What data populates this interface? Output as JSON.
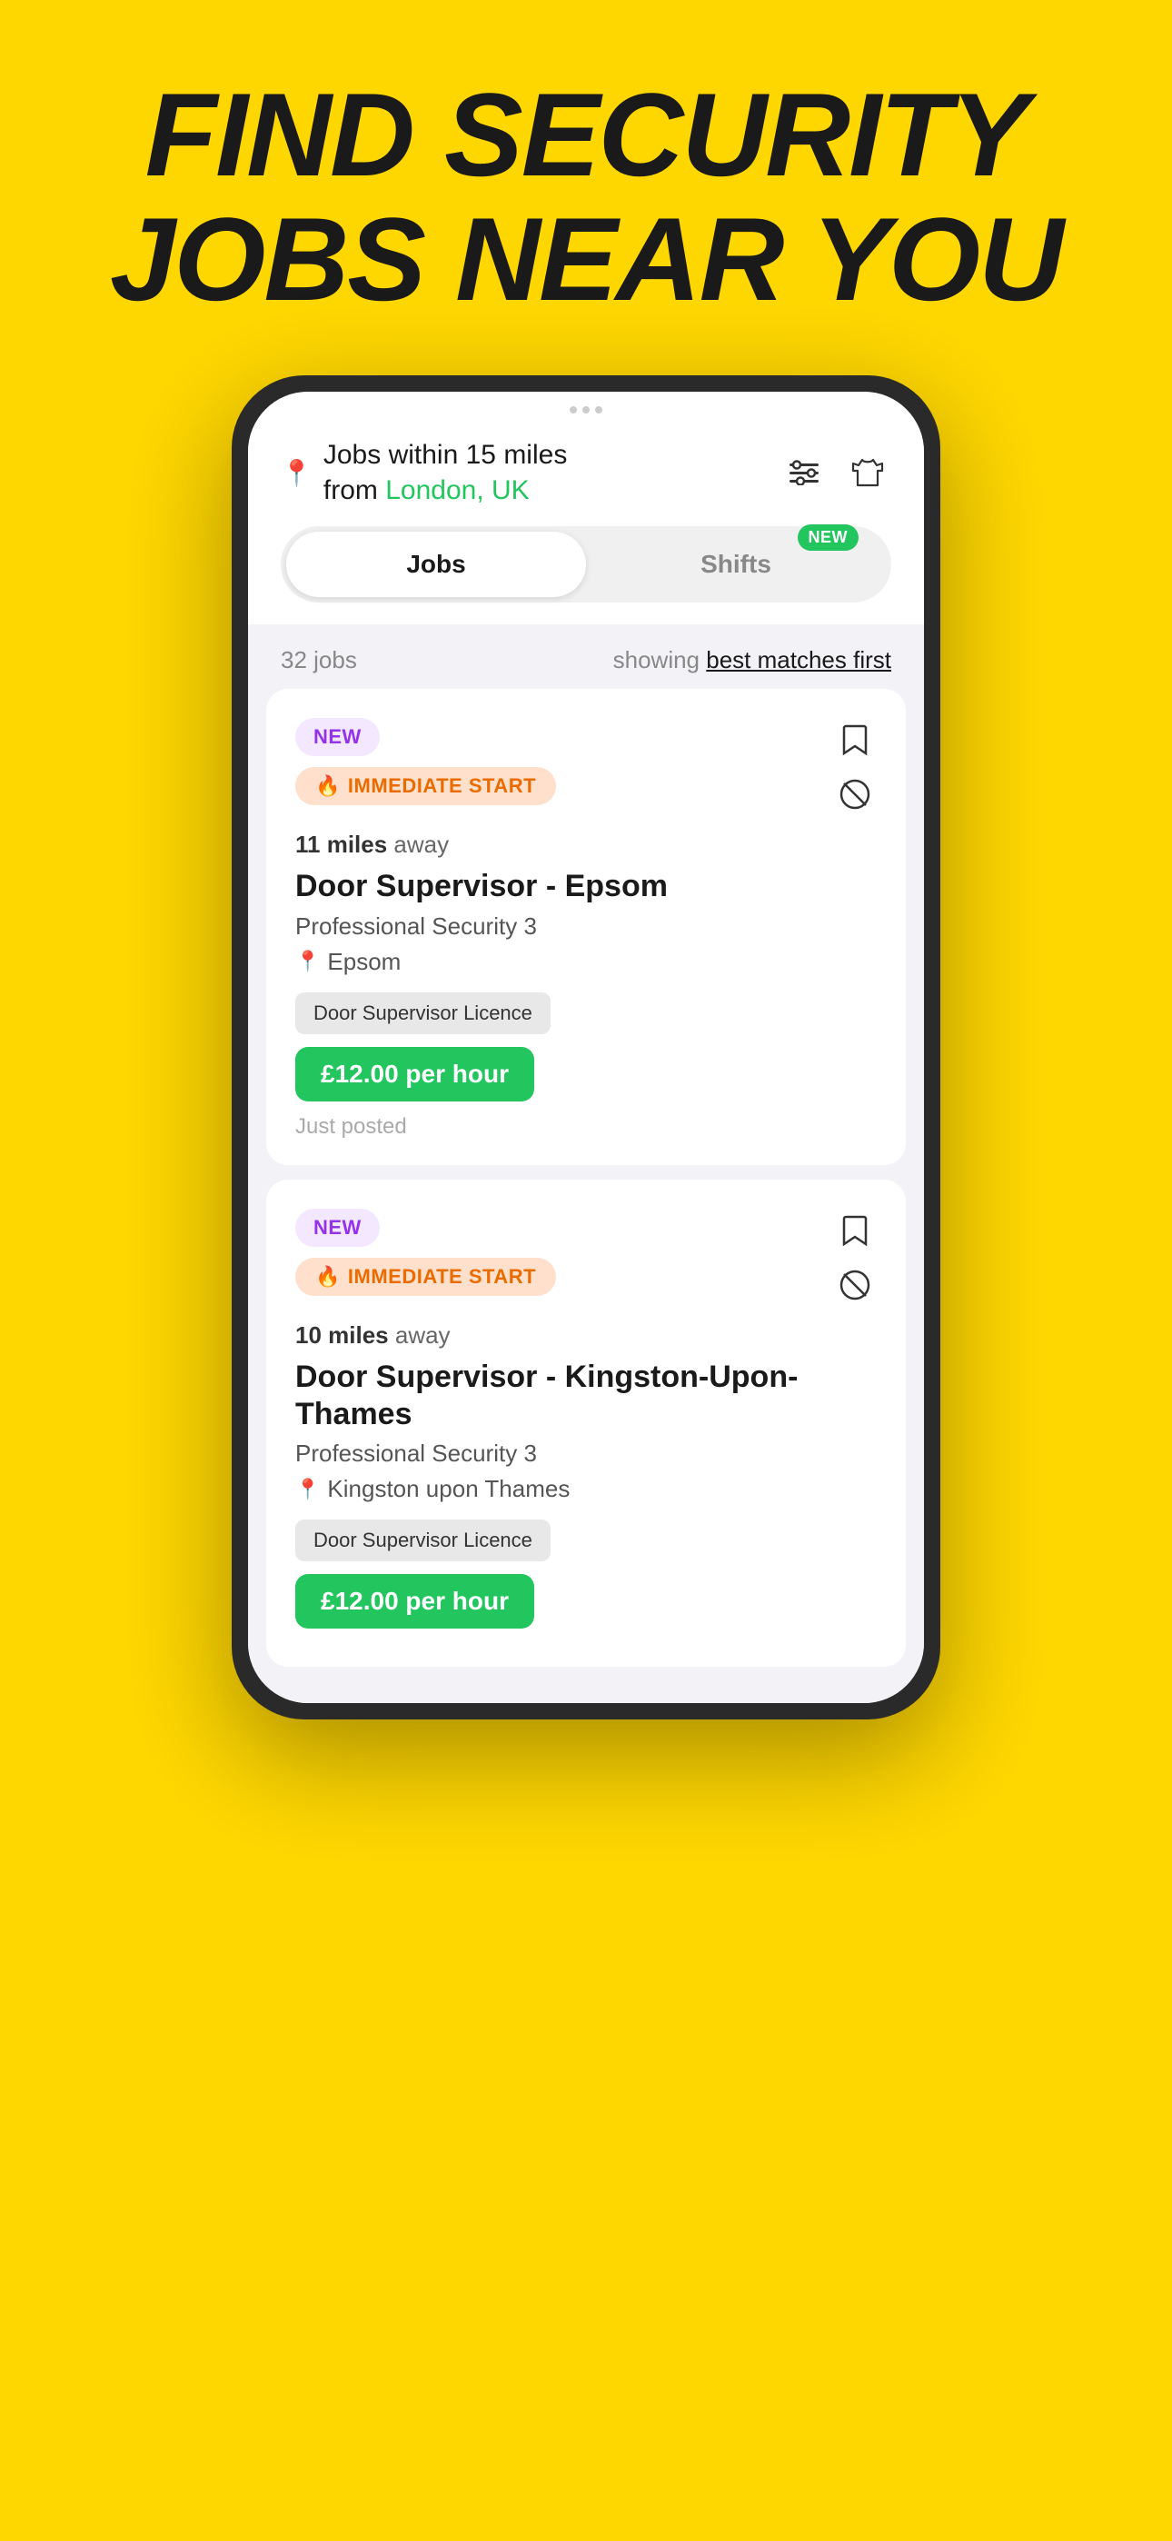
{
  "hero": {
    "title_line1": "FIND SECURITY",
    "title_line2": "JOBS NEAR YOU",
    "background_color": "#FFD700"
  },
  "header": {
    "location_prefix": "Jobs within 15 miles",
    "location_from": "from",
    "location_city": "London, UK",
    "filter_icon": "≡",
    "shirt_icon": "👕"
  },
  "tabs": {
    "jobs_label": "Jobs",
    "shifts_label": "Shifts",
    "shifts_badge": "NEW"
  },
  "jobs_meta": {
    "count": "32 jobs",
    "showing_text": "showing",
    "sort_label": "best matches first"
  },
  "jobs": [
    {
      "badge_new": "NEW",
      "badge_immediate": "IMMEDIATE START",
      "distance": "11 miles",
      "distance_suffix": "away",
      "title": "Door Supervisor - Epsom",
      "company": "Professional Security 3",
      "location": "Epsom",
      "requirement": "Door Supervisor Licence",
      "pay": "£12.00 per hour",
      "posted": "Just posted"
    },
    {
      "badge_new": "NEW",
      "badge_immediate": "IMMEDIATE START",
      "distance": "10 miles",
      "distance_suffix": "away",
      "title": "Door Supervisor - Kingston-Upon-Thames",
      "company": "Professional Security 3",
      "location": "Kingston upon Thames",
      "requirement": "Door Supervisor Licence",
      "pay": "£12.00 per hour",
      "posted": ""
    }
  ]
}
